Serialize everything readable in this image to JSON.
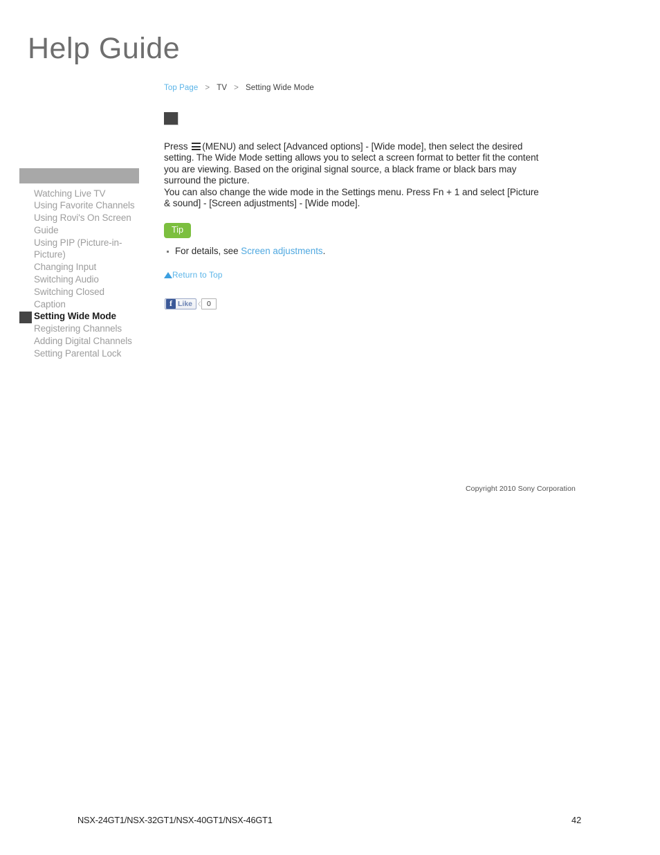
{
  "logo": {
    "text": "Help Guide"
  },
  "breadcrumb": {
    "home_label": "Top Page",
    "separator": ">",
    "section_label": "TV",
    "current_label": "Setting Wide Mode"
  },
  "sidebar": {
    "header_label": "",
    "items": [
      {
        "label": "Watching Live TV",
        "active": false
      },
      {
        "label": "Using Favorite Channels",
        "active": false
      },
      {
        "label": "Using Rovi's On Screen Guide",
        "active": false
      },
      {
        "label": "Using PIP (Picture-in-Picture)",
        "active": false
      },
      {
        "label": "Changing Input",
        "active": false
      },
      {
        "label": "Switching Audio",
        "active": false
      },
      {
        "label": "Switching Closed Caption",
        "active": false
      },
      {
        "label": "Setting Wide Mode",
        "active": true
      },
      {
        "label": "Registering Channels",
        "active": false
      },
      {
        "label": "Adding Digital Channels",
        "active": false
      },
      {
        "label": "Setting Parental Lock",
        "active": false
      }
    ]
  },
  "main": {
    "title_placeholder": "",
    "paragraph1_before_icon": "Press ",
    "menu_icon_name": "menu-hamburger-icon",
    "paragraph1_after_icon": "(MENU) and select [Advanced options] - [Wide mode], then select the desired setting. The Wide Mode setting allows you to select a screen format to better fit the content you are viewing. Based on the original signal source, a black frame or black bars may surround the picture.",
    "paragraph2": "You can also change the wide mode in the Settings menu. Press Fn + 1 and select [Picture & sound] - [Screen adjustments] - [Wide mode].",
    "tip_badge_label": "Tip",
    "tip_item_prefix": "For details, see ",
    "tip_item_link": "Screen adjustments",
    "tip_item_suffix": ".",
    "return_to_top_label": "Return to Top"
  },
  "social": {
    "facebook_glyph": "f",
    "like_label": "Like",
    "like_count": "0"
  },
  "copyright": {
    "text": "Copyright 2010 Sony Corporation"
  },
  "page_footer": {
    "models": "NSX-24GT1/NSX-32GT1/NSX-40GT1/NSX-46GT1",
    "page_number": "42"
  },
  "colors": {
    "link_blue": "#5ab4e8",
    "inline_link_blue": "#4fa8e0",
    "tip_green": "#7cbf3f",
    "sidebar_gray": "#a8a8a8",
    "sidebar_text": "#9d9d9d",
    "active_marker": "#454545",
    "facebook_blue": "#3b5998",
    "body_text": "#2b2b2b"
  }
}
